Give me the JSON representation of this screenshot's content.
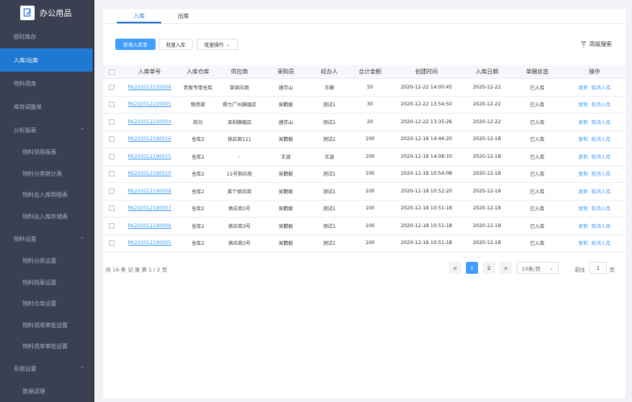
{
  "app": {
    "title": "办公用品"
  },
  "sidebar": {
    "items": [
      {
        "label": "即时库存",
        "type": "item"
      },
      {
        "label": "入库/出库",
        "type": "item",
        "active": true
      },
      {
        "label": "物料退库",
        "type": "item"
      },
      {
        "label": "库存调整单",
        "type": "item"
      },
      {
        "label": "分析报表",
        "type": "group"
      },
      {
        "label": "物料领用报表",
        "type": "sub"
      },
      {
        "label": "物料分类统计表",
        "type": "sub"
      },
      {
        "label": "物料出入库明细表",
        "type": "sub"
      },
      {
        "label": "物料出入库存储表",
        "type": "sub"
      },
      {
        "label": "物料设置",
        "type": "group"
      },
      {
        "label": "物料分类设置",
        "type": "sub"
      },
      {
        "label": "物料档案设置",
        "type": "sub"
      },
      {
        "label": "物料仓库设置",
        "type": "sub"
      },
      {
        "label": "物料领用审批设置",
        "type": "sub"
      },
      {
        "label": "物料退库审批设置",
        "type": "sub"
      },
      {
        "label": "系统设置",
        "type": "group"
      },
      {
        "label": "数据清理",
        "type": "sub"
      }
    ]
  },
  "tabs": [
    {
      "label": "入库",
      "active": true
    },
    {
      "label": "出库",
      "active": false
    }
  ],
  "toolbar": {
    "new_label": "新增入库单",
    "batch_in_label": "批量入库",
    "batch_ops_label": "批量操作",
    "advanced_search_label": "高级搜索"
  },
  "table": {
    "headers": [
      "入库单号",
      "入库仓库",
      "供应商",
      "采购员",
      "经办人",
      "合计金额",
      "创建时间",
      "入库日期",
      "单据状态",
      "操作"
    ],
    "action_copy": "复制",
    "action_cancel": "取消入库",
    "rows": [
      [
        "RK202012220006",
        "老板专用仓库",
        "某供应商",
        "速存山",
        "王峰",
        "50",
        "2020-12-22 14:00:45",
        "2020-12-22",
        "已入库"
      ],
      [
        "RK202012220005",
        "物资部",
        "得力广州旗舰店",
        "吴鹳聪",
        "测试1",
        "30",
        "2020-12-22 13:54:50",
        "2020-12-22",
        "已入库"
      ],
      [
        "RK202012220004",
        "前台",
        "深圳旗舰店",
        "速存山",
        "测试1",
        "20",
        "2020-12-22 13:35:26",
        "2020-12-22",
        "已入库"
      ],
      [
        "RK202012180016",
        "仓库2",
        "供应商111",
        "吴鹳聪",
        "测试1",
        "100",
        "2020-12-18 14:46:20",
        "2020-12-18",
        "已入库"
      ],
      [
        "RK202012180015",
        "仓库2",
        "-",
        "王波",
        "王波",
        "100",
        "2020-12-18 14:08:10",
        "2020-12-18",
        "已入库"
      ],
      [
        "RK202012180010",
        "仓库2",
        "11号供应商",
        "吴鹳聪",
        "测试1",
        "100",
        "2020-12-18 10:54:08",
        "2020-12-18",
        "已入库"
      ],
      [
        "RK202012180008",
        "仓库2",
        "某个供应商",
        "吴鹳聪",
        "测试1",
        "100",
        "2020-12-18 10:52:20",
        "2020-12-18",
        "已入库"
      ],
      [
        "RK202012180007",
        "仓库2",
        "供应商3号",
        "吴鹳聪",
        "测试1",
        "100",
        "2020-12-18 10:51:18",
        "2020-12-18",
        "已入库"
      ],
      [
        "RK202012180006",
        "仓库2",
        "供应商3号",
        "吴鹳聪",
        "测试1",
        "100",
        "2020-12-18 10:51:18",
        "2020-12-18",
        "已入库"
      ],
      [
        "RK202012180005",
        "仓库2",
        "供应商3号",
        "吴鹳聪",
        "测试1",
        "100",
        "2020-12-18 10:51:18",
        "2020-12-18",
        "已入库"
      ]
    ]
  },
  "pagination": {
    "summary": "共 16 条 记 录  第 1 / 2 页",
    "prev": "<",
    "pages": [
      "1",
      "2"
    ],
    "next": ">",
    "page_size": "10条/页",
    "goto_label": "前往",
    "goto_value": "1",
    "page_unit": "页"
  },
  "colors": {
    "accent": "#409eff",
    "sidebar_bg": "#3a3f51",
    "active_nav": "#1f78d1"
  }
}
